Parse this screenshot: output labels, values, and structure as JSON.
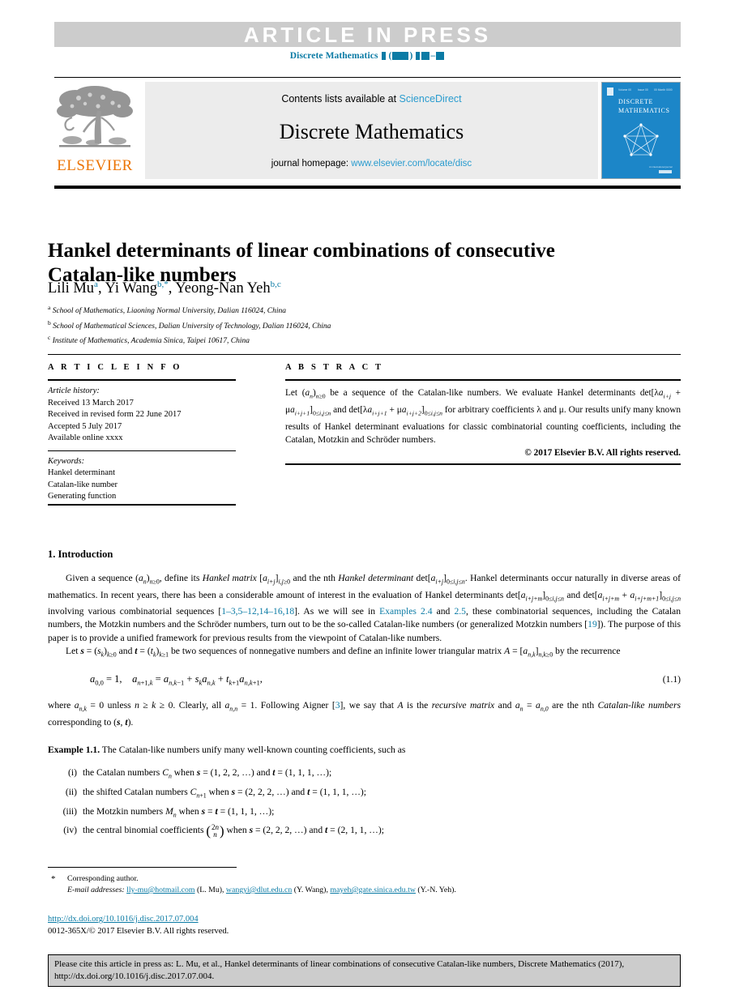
{
  "banner": {
    "text": "ARTICLE  IN  PRESS",
    "journal_line_prefix": "Discrete Mathematics",
    "journal_line_masked": "▮ (▮▮▮▮) ▮▮–▮▮",
    "background_color": "#cccccc",
    "text_color": "#ffffff",
    "accent_color": "#0b7ba5"
  },
  "masthead": {
    "publisher_name": "ELSEVIER",
    "contents_prefix": "Contents lists available at ",
    "contents_link": "ScienceDirect",
    "journal_title": "Discrete Mathematics",
    "homepage_prefix": "journal homepage: ",
    "homepage_link": "www.elsevier.com/locate/disc",
    "cover": {
      "title_line1": "DISCRETE",
      "title_line2": "MATHEMATICS",
      "header_meta": "Volume 00  Issue 00  00 Month 0000",
      "footer_meta": "An international journal",
      "background_color": "#1c86c8"
    }
  },
  "article": {
    "title": "Hankel determinants of linear combinations of consecutive Catalan-like numbers",
    "authors_html": "Lili Mu <sup>a</sup>, Yi Wang <sup>b,*</sup>, Yeong-Nan Yeh <sup>b,c</sup>",
    "affiliations": [
      {
        "mark": "a",
        "text": "School of Mathematics, Liaoning Normal University, Dalian 116024, China"
      },
      {
        "mark": "b",
        "text": "School of Mathematical Sciences, Dalian University of Technology, Dalian 116024, China"
      },
      {
        "mark": "c",
        "text": "Institute of Mathematics, Academia Sinica, Taipei 10617, China"
      }
    ]
  },
  "info": {
    "heading": "A R T I C L E   I N F O",
    "history_label": "Article history:",
    "history": [
      "Received 13 March 2017",
      "Received in revised form 22 June 2017",
      "Accepted 5 July 2017",
      "Available online xxxx"
    ],
    "keywords_label": "Keywords:",
    "keywords": [
      "Hankel determinant",
      "Catalan-like number",
      "Generating function"
    ]
  },
  "abstract": {
    "heading": "A B S T R A C T",
    "copyright": "© 2017 Elsevier B.V. All rights reserved."
  },
  "sections": {
    "introduction_number": "1.",
    "introduction_title": "Introduction",
    "equation_number": "(1.1)",
    "example_label": "Example 1.1.",
    "example_intro": "The Catalan-like numbers unify many well-known counting coefficients, such as",
    "example_items": [
      {
        "roman": "(i)",
        "text": "the Catalan numbers Cₙ when 𝐔 = (1, 2, 2, …) and 𝐓 = (1, 1, 1, …);"
      },
      {
        "roman": "(ii)",
        "text": "the shifted Catalan numbers Cₙ₊₁ when 𝐔 = (2, 2, 2, …) and 𝐓 = (1, 1, 1, …);"
      },
      {
        "roman": "(iii)",
        "text": "the Motzkin numbers Mₙ when 𝐔 = 𝐓 = (1, 1, 1, …);"
      },
      {
        "roman": "(iv)",
        "text": "the central binomial coefficients when 𝐔 = (2, 2, 2, …) and 𝐓 = (2, 1, 1, …);"
      }
    ]
  },
  "references_inline": {
    "range_1": "1–3,5–12,14–16,18",
    "examples_a": "Examples 2.4",
    "examples_b": "2.5",
    "ref_19": "19",
    "ref_3": "3"
  },
  "footnote": {
    "corresponding_mark": "*",
    "corresponding_text": "Corresponding author.",
    "email_label": "E-mail addresses:",
    "emails": [
      {
        "address": "lly-mu@hotmail.com",
        "owner": "(L. Mu)"
      },
      {
        "address": "wangyi@dlut.edu.cn",
        "owner": "(Y. Wang)"
      },
      {
        "address": "mayeh@gate.sinica.edu.tw",
        "owner": "(Y.-N. Yeh)"
      }
    ],
    "doi_url": "http://dx.doi.org/10.1016/j.disc.2017.07.004",
    "issn_line": "0012-365X/© 2017 Elsevier B.V. All rights reserved."
  },
  "citation_box": {
    "text": "Please cite this article in press as: L. Mu, et al., Hankel determinants of linear combinations of consecutive Catalan-like numbers, Discrete Mathematics (2017), http://dx.doi.org/10.1016/j.disc.2017.07.004."
  }
}
